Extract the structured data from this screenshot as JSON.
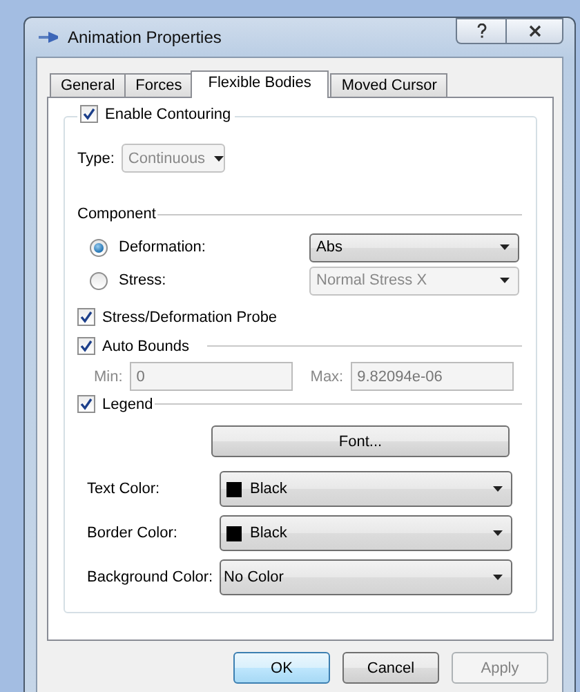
{
  "window": {
    "title": "Animation Properties"
  },
  "tabs": [
    {
      "label": "General",
      "selected": false
    },
    {
      "label": "Forces",
      "selected": false
    },
    {
      "label": "Flexible Bodies",
      "selected": true
    },
    {
      "label": "Moved Cursor",
      "selected": false
    }
  ],
  "enable_contouring": {
    "label": "Enable Contouring",
    "checked": true
  },
  "type": {
    "label": "Type:",
    "value": "Continuous",
    "disabled": true
  },
  "component": {
    "title": "Component",
    "options": [
      {
        "label": "Deformation:",
        "selected": true,
        "value": "Abs",
        "disabled": false
      },
      {
        "label": "Stress:",
        "selected": false,
        "value": "Normal Stress X",
        "disabled": true
      }
    ]
  },
  "probe": {
    "label": "Stress/Deformation Probe",
    "checked": true
  },
  "auto_bounds": {
    "label": "Auto Bounds",
    "checked": true,
    "min": {
      "label": "Min:",
      "value": "0"
    },
    "max": {
      "label": "Max:",
      "value": "9.82094e-06"
    }
  },
  "legend": {
    "label": "Legend",
    "checked": true,
    "font_button": "Font...",
    "rows": [
      {
        "label": "Text Color:",
        "value": "Black",
        "color": "#000000"
      },
      {
        "label": "Border Color:",
        "value": "Black",
        "color": "#000000"
      },
      {
        "label": "Background Color:",
        "value": "No Color"
      }
    ]
  },
  "buttons": [
    {
      "label": "OK",
      "default": true,
      "disabled": false
    },
    {
      "label": "Cancel",
      "default": false,
      "disabled": false
    },
    {
      "label": "Apply",
      "default": false,
      "disabled": true
    }
  ]
}
